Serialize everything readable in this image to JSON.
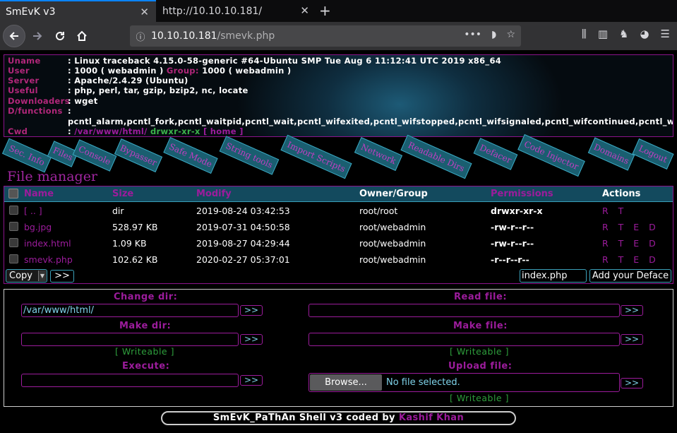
{
  "browser": {
    "tabs": [
      {
        "title": "SmEvK v3",
        "active": true
      },
      {
        "title": "http://10.10.10.181/",
        "active": false
      }
    ],
    "url_host": "10.10.10.181",
    "url_path": "/smevk.php",
    "colors": {
      "chrome": "#323234",
      "tabbar": "#0c0c0d",
      "accent": "#0a84ff"
    }
  },
  "info": {
    "uname_key": "Uname",
    "uname": ": Linux traceback 4.15.0-58-generic #64-Ubuntu SMP Tue Aug 6 11:12:41 UTC 2019 x86_64",
    "user_key": "User",
    "user_prefix": ": 1000 ( webadmin )",
    "group_label": "Group:",
    "group_val": "1000 ( webadmin )",
    "server_key": "Server",
    "server": ": Apache/2.4.29 (Ubuntu)",
    "useful_key": "Useful",
    "useful": ": php, perl, tar, gzip, bzip2, nc, locate",
    "downloaders_key": "Downloaders",
    "downloaders": ": wget",
    "dfunctions_key": "D/functions",
    "dfunctions_colon": ":",
    "dfunctions": "pcntl_alarm,pcntl_fork,pcntl_waitpid,pcntl_wait,pcntl_wifexited,pcntl_wifstopped,pcntl_wifsignaled,pcntl_wifcontinued,pcntl_wexitstatus,pc",
    "cwd_key": "Cwd",
    "cwd_colon": ":",
    "cwd_path": "/var/www/html/",
    "cwd_perm": "drwxr-xr-x",
    "cwd_home": "[ home ]"
  },
  "menu": [
    "Sec. Info",
    "Files",
    "Console",
    "Bypasser",
    "Safe Mode",
    "String tools",
    "Import Scripts",
    "Network",
    "Readable Dirs",
    "Defacer",
    "Code Injector",
    "Domains",
    "Logout"
  ],
  "file_manager": {
    "title": "File manager",
    "columns": [
      "Name",
      "Size",
      "Modify",
      "Owner/Group",
      "Permissions",
      "Actions"
    ],
    "rows": [
      {
        "name": "[ .. ]",
        "size": "dir",
        "modify": "2019-08-24 03:42:53",
        "owner": "root/root",
        "perms": "drwxr-xr-x",
        "actions": "R T"
      },
      {
        "name": "bg.jpg",
        "size": "528.97 KB",
        "modify": "2019-07-31 04:50:58",
        "owner": "root/webadmin",
        "perms": "-rw-r--r--",
        "actions": "R T E D"
      },
      {
        "name": "index.html",
        "size": "1.09 KB",
        "modify": "2019-08-27 04:29:44",
        "owner": "root/webadmin",
        "perms": "-rw-r--r--",
        "actions": "R T E D"
      },
      {
        "name": "smevk.php",
        "size": "102.62 KB",
        "modify": "2020-02-27 05:37:01",
        "owner": "root/webadmin",
        "perms": "-r--r--r--",
        "actions": "R T E D"
      }
    ],
    "copy_option": "Copy",
    "go_label": ">>",
    "deface_value": "index.php",
    "deface_button": "Add your Deface"
  },
  "tools": {
    "change_dir_label": "Change dir:",
    "change_dir_value": "/var/www/html/",
    "make_dir_label": "Make dir:",
    "writeable_1": "[ Writeable ]",
    "execute_label": "Execute:",
    "read_file_label": "Read file:",
    "make_file_label": "Make file:",
    "writeable_2": "[ Writeable ]",
    "upload_label": "Upload file:",
    "browse_label": "Browse...",
    "no_file": "No file selected.",
    "writeable_3": "[ Writeable ]",
    "go": ">>"
  },
  "footer": {
    "text": "SmEvK_PaThAn Shell v3 coded by",
    "author": "Kashif Khan"
  },
  "theme": {
    "accent": "#9c1c9c",
    "teal": "#134a5e",
    "green": "#2e9e3c"
  }
}
